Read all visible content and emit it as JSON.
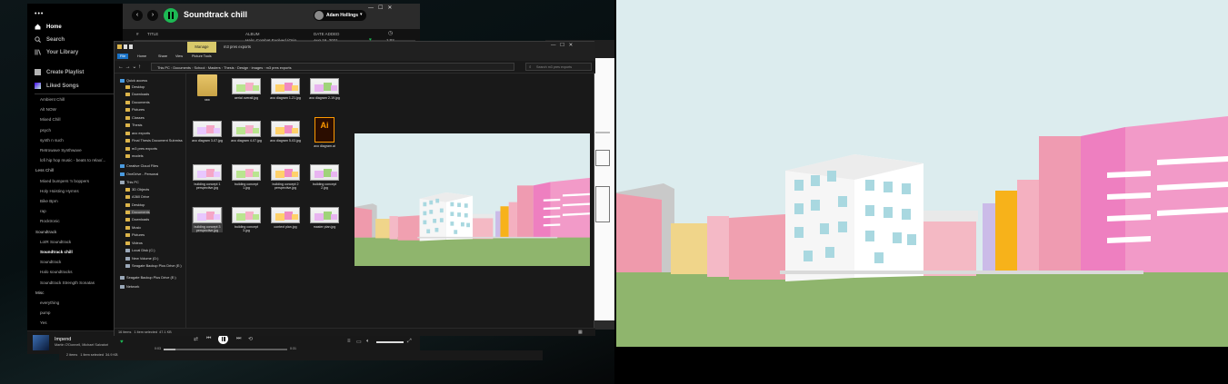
{
  "spotify": {
    "title": "Soundtrack chill",
    "user": "Adam Hollings",
    "nav": {
      "home": "Home",
      "search": "Search",
      "library": "Your Library",
      "create": "Create Playlist",
      "liked": "Liked Songs"
    },
    "playlists": [
      "Ambient Chill",
      "Alt NOW",
      "Mixed Chill",
      "psych",
      "synth n such",
      "Retrowave Synthwave",
      "lofi hip hop music - beats to relax/...",
      "Less Chill",
      "Mixed bumpers 'n boppers",
      "Holy Hoisting Hymns",
      "Bike Bpm",
      "rap",
      "Rocktronic",
      "Soundtrack",
      "LotR Soundtrack",
      "Soundtrack chill",
      "Soundtrack",
      "Halo soundtracks",
      "Soundtrack Strength Sonatas",
      "Misc",
      "everything",
      "pump",
      "Yes"
    ],
    "columns": {
      "num": "#",
      "title": "TITLE",
      "album": "ALBUM",
      "date": "DATE ADDED"
    },
    "row": {
      "album": "Halo: Combat Evolved (Orig...",
      "date": "Aug 16, 2021",
      "duration": "1:02"
    },
    "now_playing": {
      "title": "Impend",
      "artist": "Martin O'Donnell, Michael Salvatori",
      "elapsed": "0:03",
      "total": "0:31"
    }
  },
  "explorer": {
    "title": "m3 pres exports",
    "manage": "Manage",
    "tabs": [
      "File",
      "Home",
      "Share",
      "View",
      "Picture Tools"
    ],
    "path": [
      "This PC",
      "Documents",
      "School",
      "Masters",
      "Thesis",
      "Design",
      "images",
      "m3 pres exports"
    ],
    "search_placeholder": "Search m3 pres exports",
    "nav": [
      "Quick access",
      "Desktop",
      "Downloads",
      "Documents",
      "Pictures",
      "Classes",
      "Thesis",
      "axo exports",
      "Final Thesis Document Submiss",
      "m3 pres exports",
      "models",
      "Creative Cloud Files",
      "OneDrive - Personal",
      "This PC",
      "3D Objects",
      "A360 Drive",
      "Desktop",
      "Documents",
      "Downloads",
      "Music",
      "Pictures",
      "Videos",
      "Local Disk (C:)",
      "New Volume (D:)",
      "Seagate Backup Plus Drive (E:)",
      "Seagate Backup Plus Drive (E:)",
      "Network"
    ],
    "files": [
      "raw",
      "aerial overall.jpg",
      "axo diagram 1-21.jpg",
      "axo diagram 2-19.jpg",
      "axo diagram 3-07.jpg",
      "axo diagram 4-07.jpg",
      "axo diagram 5-03.jpg",
      "axo diagram.ai",
      "building concept 1 perspective.jpg",
      "building concept 1.jpg",
      "building concept 2 perspective.jpg",
      "building concept 2.jpg",
      "building concept 3 perspective.jpg",
      "building concept 3.jpg",
      "context plan.jpg",
      "master plan.jpg"
    ],
    "ai_label": "Ai",
    "status": "16 items   1 item selected  47.1 KB",
    "back_status": "2 items   1 item selected  34.9 KB"
  },
  "colors": {
    "spotify_green": "#1db954",
    "sky": "#dcecee",
    "grass": "#8fb56d",
    "pink": "#ee7fc0",
    "ai_orange": "#ff9a00"
  }
}
